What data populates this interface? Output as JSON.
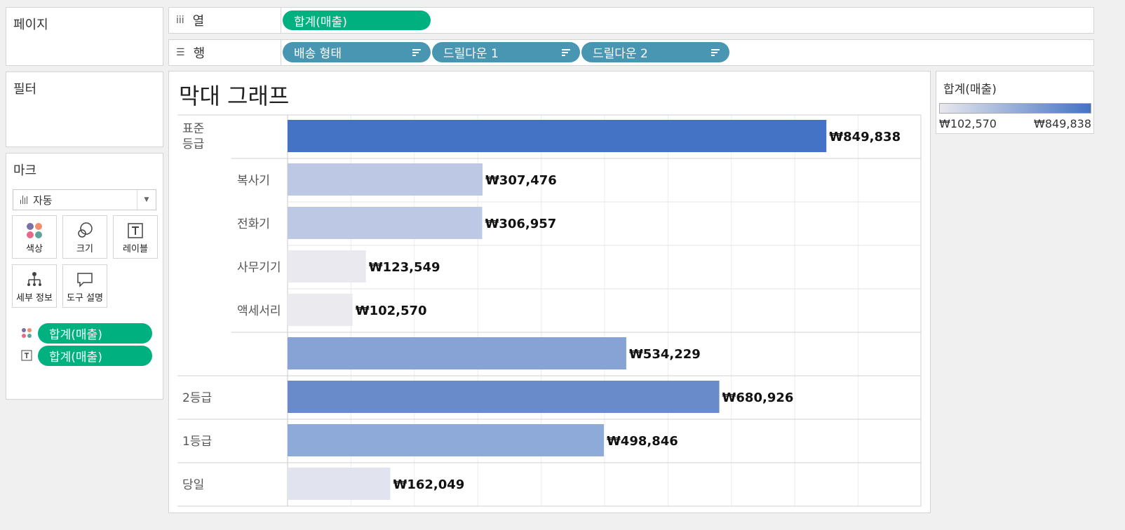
{
  "sidebar": {
    "pages_title": "페이지",
    "filters_title": "필터",
    "marks_title": "마크",
    "mark_type": "자동",
    "mark_type_icon": "bar-chart-icon",
    "buttons": [
      {
        "label": "색상",
        "icon": "color-dots-icon"
      },
      {
        "label": "크기",
        "icon": "size-circles-icon"
      },
      {
        "label": "레이블",
        "icon": "text-label-icon"
      },
      {
        "label": "세부 정보",
        "icon": "detail-tree-icon"
      },
      {
        "label": "도구 설명",
        "icon": "tooltip-bubble-icon"
      }
    ],
    "mark_fields": [
      {
        "label": "합계(매출)",
        "icon": "color-dots-icon"
      },
      {
        "label": "합계(매출)",
        "icon": "text-label-icon"
      }
    ]
  },
  "shelves": {
    "columns_label": "열",
    "columns_icon": "columns-icon",
    "columns_pill": "합계(매출)",
    "rows_label": "행",
    "rows_icon": "rows-icon",
    "rows_pills": [
      "배송 형태",
      "드릴다운 1",
      "드릴다운 2"
    ]
  },
  "legend": {
    "title": "합계(매출)",
    "min_label": "₩102,570",
    "max_label": "₩849,838",
    "color_min": "#e8e8ed",
    "color_max": "#4472c4"
  },
  "chart_data": {
    "type": "bar",
    "title": "막대 그래프",
    "orientation": "horizontal",
    "xlim": [
      0,
      1000000
    ],
    "grid": true,
    "rows": [
      {
        "group": "표준 등급",
        "sub": "",
        "value": 849838,
        "label": "₩849,838",
        "color": "#4472c4"
      },
      {
        "group": "",
        "sub": "복사기",
        "value": 307476,
        "label": "₩307,476",
        "color": "#bcc8e4"
      },
      {
        "group": "",
        "sub": "전화기",
        "value": 306957,
        "label": "₩306,957",
        "color": "#bcc8e4"
      },
      {
        "group": "",
        "sub": "사무기기",
        "value": 123549,
        "label": "₩123,549",
        "color": "#e9e9ef"
      },
      {
        "group": "",
        "sub": "액세서리",
        "value": 102570,
        "label": "₩102,570",
        "color": "#ebebef"
      },
      {
        "group": "",
        "sub": "",
        "value": 534229,
        "label": "₩534,229",
        "color": "#87a3d6"
      },
      {
        "group": "2등급",
        "sub": "",
        "value": 680926,
        "label": "₩680,926",
        "color": "#6a8bca"
      },
      {
        "group": "1등급",
        "sub": "",
        "value": 498846,
        "label": "₩498,846",
        "color": "#8eaad9"
      },
      {
        "group": "당일",
        "sub": "",
        "value": 162049,
        "label": "₩162,049",
        "color": "#e1e4ee"
      }
    ]
  }
}
